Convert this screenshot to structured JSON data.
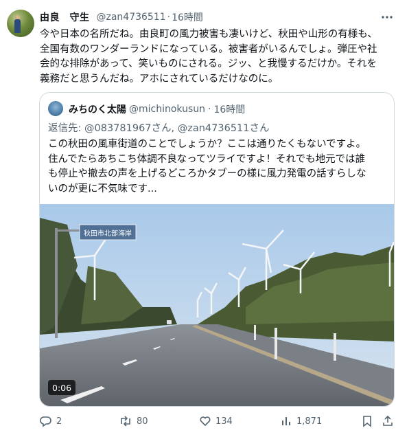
{
  "tweet": {
    "author_name": "由良　守生",
    "author_handle": "@zan4736511",
    "separator": "·",
    "time": "16時間",
    "text_lines": [
      "今や日本の名所だね。由良町の風力被害も凄いけど、秋田や山形の有様も、",
      "全国有数のワンダーランドになっている。被害者がいるんでしょ。弾圧や社",
      "会的な排除があって、笑いものにされる。ジッ、と我慢するだけか。それを",
      "義務だと思うんだね。アホにされているだけなのに。"
    ],
    "icons": {
      "avatar": "avatar-image",
      "more": "more-icon"
    }
  },
  "quote": {
    "author_name": "みちのく太陽",
    "author_handle": "@michinokusun",
    "separator": "·",
    "time": "16時間",
    "reply_to": "返信先: @083781967さん, @zan4736511さん",
    "text_lines": [
      "この秋田の風車街道のことでしょうか？ここは通りたくもないですよ。",
      "住んでたらあちこち体調不良なってツライですよ！それでも地元では誰",
      "も停止や撤去の声を上げるどころかタブーの様に風力発電の話すらしな",
      "いのが更に不気味です..."
    ],
    "video": {
      "duration": "0:06",
      "road_sign": "秋田市北部海岸",
      "description_icon": "video-thumbnail"
    }
  },
  "actions": {
    "replies": "2",
    "retweets": "80",
    "likes": "134",
    "views": "1,871",
    "icons": [
      "reply-icon",
      "retweet-icon",
      "like-icon",
      "views-icon",
      "bookmark-icon",
      "share-icon"
    ]
  },
  "colors": {
    "text": "#0f1419",
    "muted": "#536471",
    "border": "#cfd9de",
    "sky": "#b9d3ea"
  }
}
